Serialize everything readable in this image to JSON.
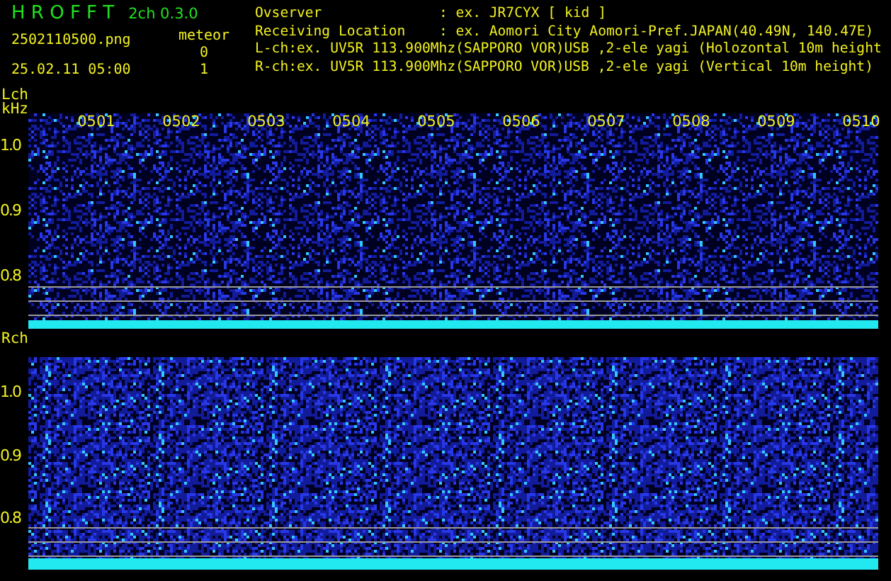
{
  "header": {
    "app_title": "H R O F F T",
    "version": "2ch 0.3.0",
    "filename": "2502110500.png",
    "datetime": "25.02.11 05:00",
    "meteor_label": "meteor",
    "meteor_counts": [
      "0",
      "1"
    ]
  },
  "info": [
    {
      "label": "Ovserver",
      "value": ": ex. JR7CYX [ kid ]"
    },
    {
      "label": "Receiving Location",
      "value": ": ex. Aomori City Aomori-Pref.JAPAN(40.49N, 140.47E)"
    },
    {
      "label": "L-ch:ex. UV5R 113.900Mhz(SAPPORO VOR)USB ,2-ele yagi (Holozontal 10m height"
    },
    {
      "label": "R-ch:ex. UV5R 113.900Mhz(SAPPORO VOR)USB ,2-ele yagi (Vertical 10m height)"
    }
  ],
  "channels": [
    {
      "label": "Lch",
      "unit": "kHz",
      "time_ticks": [
        "0501",
        "0502",
        "0503",
        "0504",
        "0505",
        "0506",
        "0507",
        "0508",
        "0509",
        "0510"
      ],
      "freq_ticks": [
        "1.0",
        "0.9",
        "0.8"
      ]
    },
    {
      "label": "Rch",
      "freq_ticks": [
        "1.0",
        "0.9",
        "0.8"
      ]
    }
  ]
}
